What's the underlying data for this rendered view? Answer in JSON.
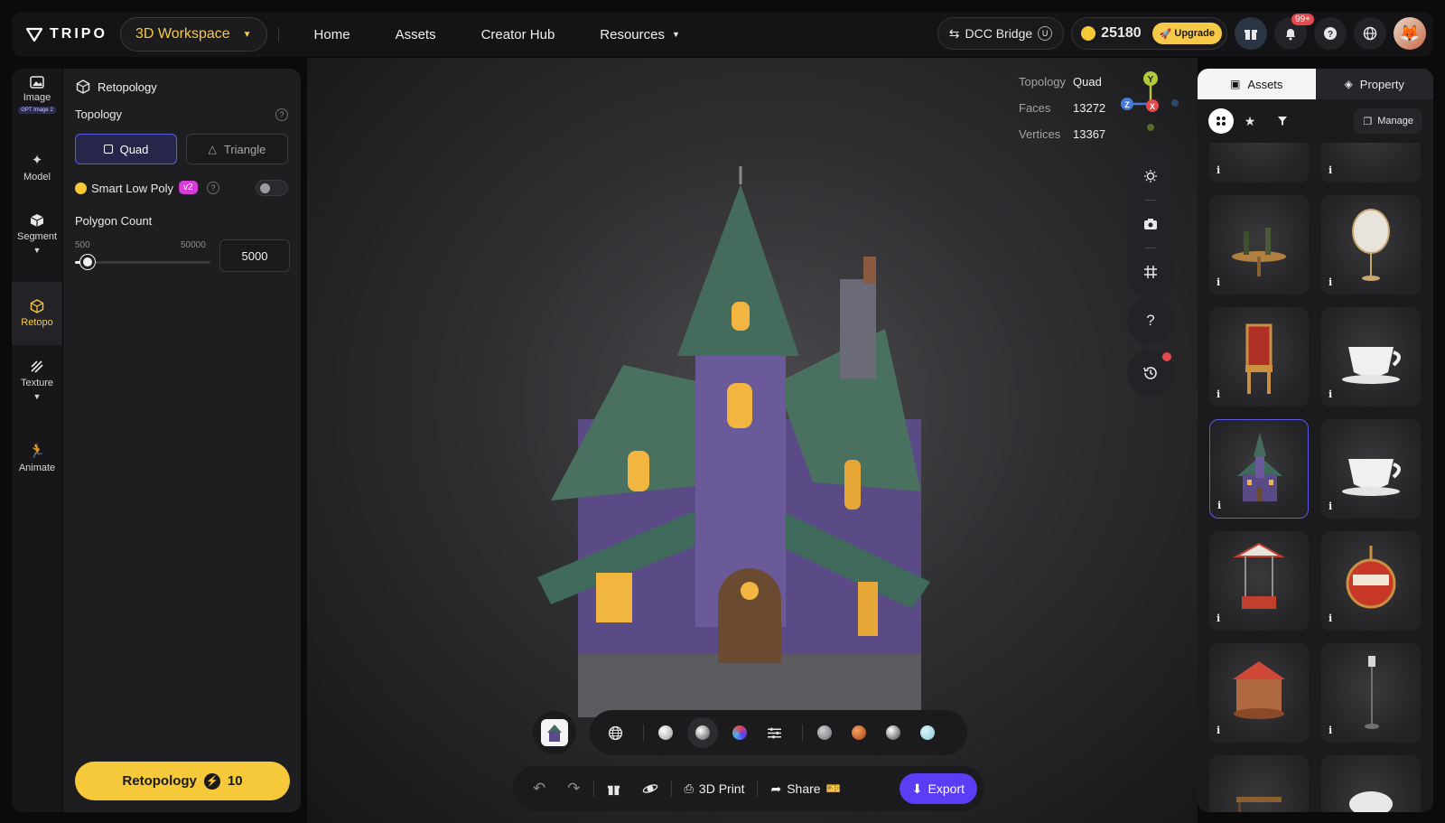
{
  "header": {
    "logo_text": "TRIPO",
    "workspace_label": "3D Workspace",
    "nav": [
      "Home",
      "Assets",
      "Creator Hub",
      "Resources"
    ],
    "dcc_label": "DCC Bridge",
    "credits": "25180",
    "upgrade_label": "Upgrade",
    "notif_badge": "99+"
  },
  "rail": {
    "items": [
      {
        "label": "Image",
        "chip": "GPT Image 2"
      },
      {
        "label": "Model"
      },
      {
        "label": "Segment"
      },
      {
        "label": "Retopo"
      },
      {
        "label": "Texture"
      },
      {
        "label": "Animate"
      }
    ]
  },
  "panel": {
    "title": "Retopology",
    "topology_label": "Topology",
    "quad_label": "Quad",
    "triangle_label": "Triangle",
    "smart_label": "Smart Low Poly",
    "smart_badge": "v2",
    "polygon_label": "Polygon Count",
    "slider_min": "500",
    "slider_max": "50000",
    "polygon_value": "5000",
    "slider_fraction": 0.09,
    "retopo_button": "Retopology",
    "retopo_cost": "10"
  },
  "stats": {
    "topology_k": "Topology",
    "topology_v": "Quad",
    "faces_k": "Faces",
    "faces_v": "13272",
    "vertices_k": "Vertices",
    "vertices_v": "13367",
    "axis_y": "Y",
    "axis_x": "X",
    "axis_z": "Z"
  },
  "actions": {
    "print_label": "3D Print",
    "share_label": "Share",
    "export_label": "Export"
  },
  "assets_panel": {
    "tab_assets": "Assets",
    "tab_property": "Property",
    "manage_label": "Manage",
    "info_glyph": "i",
    "cards": [
      "table",
      "table",
      "round-table-with-bottles",
      "mirror",
      "red-throne-chair",
      "teacup",
      "haunted-house",
      "teacup",
      "swing-chair",
      "gondola",
      "carousel",
      "street-lamp",
      "bench",
      "cloud"
    ]
  },
  "colors": {
    "accent_yellow": "#f5c93a",
    "accent_purple": "#5b3df5",
    "selected_border": "#5b5be8"
  }
}
